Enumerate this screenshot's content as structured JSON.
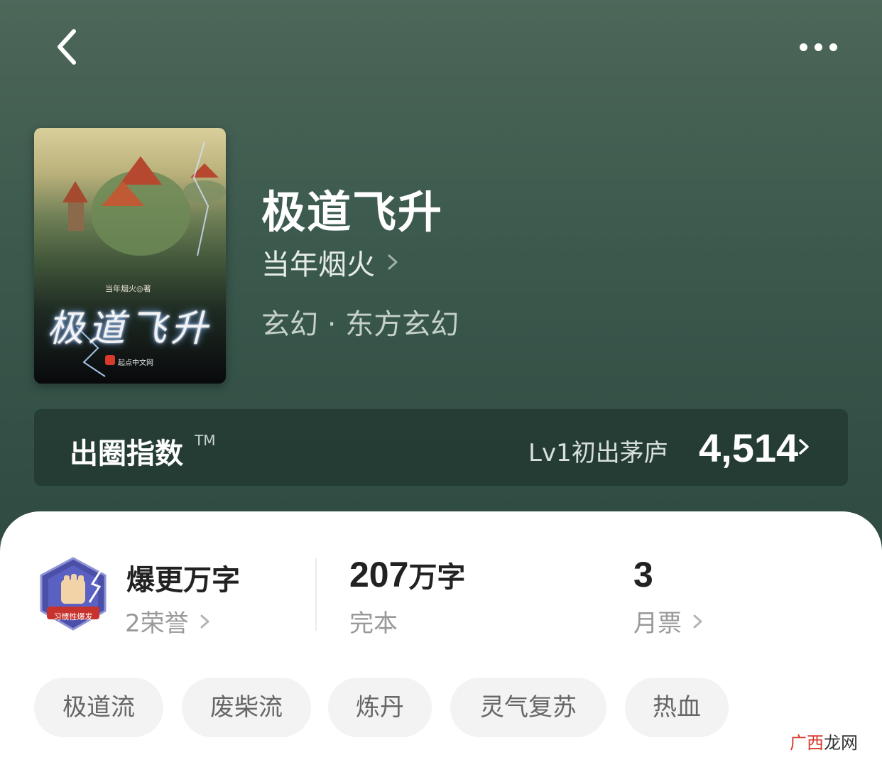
{
  "header": {
    "back_icon": "chevron-left-icon",
    "more_icon": "more-horizontal-icon"
  },
  "book": {
    "title": "极道飞升",
    "author": "当年烟火",
    "genre": "玄幻 · 东方玄幻",
    "cover": {
      "author_text": "当年烟火◎著",
      "title_text": "极道飞升",
      "publisher_text": "起点中文网"
    }
  },
  "index": {
    "label": "出圈指数",
    "tm": "TM",
    "level": "Lv1初出茅庐",
    "score": "4,514"
  },
  "stats": {
    "badge": {
      "icon": "fist-badge-icon",
      "badge_text": "习惯性爆发",
      "title": "爆更万字",
      "sub": "2荣誉"
    },
    "words": {
      "value": "207",
      "unit": "万字",
      "sub": "完本"
    },
    "votes": {
      "value": "3",
      "sub": "月票"
    }
  },
  "tags": [
    "极道流",
    "废柴流",
    "炼丹",
    "灵气复苏",
    "热血"
  ],
  "watermark": {
    "part1": "广西",
    "part2": "龙网"
  },
  "colors": {
    "hero_bg": "#3b594d",
    "card_bg": "#ffffff",
    "tag_bg": "#f3f3f3",
    "accent_red": "#d6372b"
  }
}
